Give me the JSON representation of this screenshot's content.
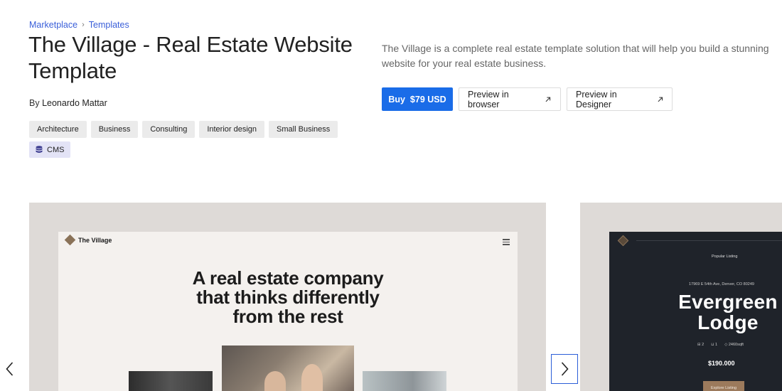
{
  "breadcrumb": {
    "items": [
      "Marketplace",
      "Templates"
    ]
  },
  "title": "The Village - Real Estate Website Template",
  "byline": {
    "prefix": "By",
    "author": "Leonardo Mattar"
  },
  "tags": [
    "Architecture",
    "Business",
    "Consulting",
    "Interior design",
    "Small Business"
  ],
  "cms_tag": {
    "label": "CMS",
    "icon": "database-icon"
  },
  "description": "The Village is a complete real estate template solution that will help you build a stunning website for your real estate business.",
  "actions": {
    "buy_label": "Buy  $79 USD",
    "preview_browser_label": "Preview in browser",
    "preview_designer_label": "Preview in Designer",
    "external_icon": "arrow-up-right-icon"
  },
  "colors": {
    "accent": "#1a6ce8",
    "link": "#3a5fd9",
    "slide_bg": "#dedad7",
    "dark_mock_bg": "#1f232a",
    "brown": "#8a7258"
  },
  "carousel": {
    "slide1": {
      "brand": "The Village",
      "headline_lines": [
        "A real estate company",
        "that thinks differently",
        "from the rest"
      ]
    },
    "slide2": {
      "popular": "Popular Listing",
      "address": "17969 E 54th Ave, Denver, CO 80249",
      "name_lines": [
        "Evergreen",
        "Lodge"
      ],
      "specs": [
        "2",
        "1",
        "2460sqft"
      ],
      "price": "$190.000",
      "cta": "Explore Listing"
    },
    "prev_icon": "chevron-left-icon",
    "next_icon": "chevron-right-icon"
  }
}
